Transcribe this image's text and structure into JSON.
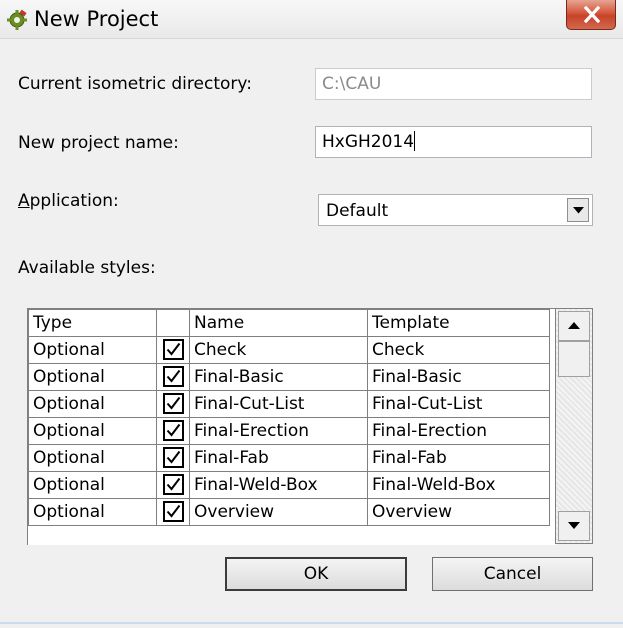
{
  "window": {
    "title": "New Project",
    "icon": "gear-plug-icon",
    "close_icon": "close-icon"
  },
  "form": {
    "iso_dir_label": "Current isometric directory:",
    "iso_dir_value": "C:\\CAU",
    "project_name_label": "New project name:",
    "project_name_value": "HxGH2014",
    "application_label_mnemonic": "A",
    "application_label_rest": "pplication:",
    "application_value": "Default",
    "styles_label": "Available styles:"
  },
  "table": {
    "headers": [
      "Type",
      "",
      "Name",
      "Template"
    ],
    "rows": [
      {
        "type": "Optional",
        "checked": true,
        "name": "Check",
        "template": "Check"
      },
      {
        "type": "Optional",
        "checked": true,
        "name": "Final-Basic",
        "template": "Final-Basic"
      },
      {
        "type": "Optional",
        "checked": true,
        "name": "Final-Cut-List",
        "template": "Final-Cut-List"
      },
      {
        "type": "Optional",
        "checked": true,
        "name": "Final-Erection",
        "template": "Final-Erection"
      },
      {
        "type": "Optional",
        "checked": true,
        "name": "Final-Fab",
        "template": "Final-Fab"
      },
      {
        "type": "Optional",
        "checked": true,
        "name": "Final-Weld-Box",
        "template": "Final-Weld-Box"
      },
      {
        "type": "Optional",
        "checked": true,
        "name": "Overview",
        "template": "Overview"
      }
    ]
  },
  "buttons": {
    "ok": "OK",
    "cancel": "Cancel"
  }
}
